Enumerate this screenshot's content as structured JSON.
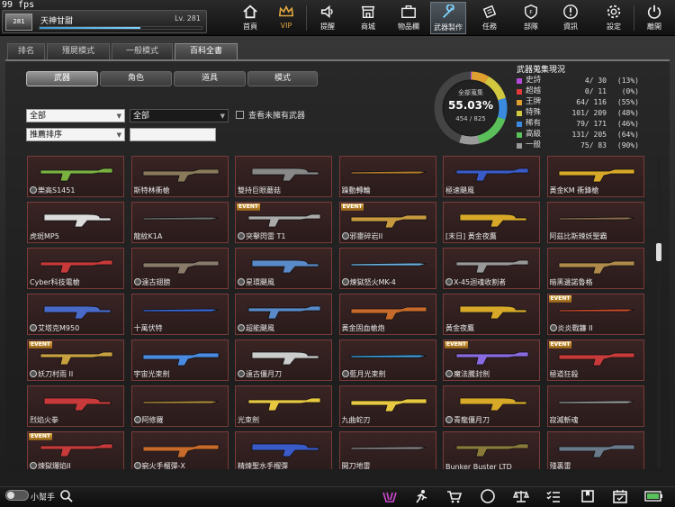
{
  "fps": "99 fps",
  "player": {
    "name": "天神甘甜",
    "level": "Lv. 281",
    "rank": "281",
    "exp_fraction": 0.62
  },
  "nav": [
    {
      "label": "首頁",
      "icon": "home-icon"
    },
    {
      "label": "VIP",
      "icon": "crown-icon"
    },
    {
      "label": "提醒",
      "icon": "speaker-icon"
    },
    {
      "label": "商城",
      "icon": "shop-icon"
    },
    {
      "label": "物品欄",
      "icon": "briefcase-icon"
    },
    {
      "label": "武器製作",
      "icon": "wrench-icon"
    },
    {
      "label": "任務",
      "icon": "ticket-icon"
    },
    {
      "label": "部隊",
      "icon": "clan-icon"
    },
    {
      "label": "資訊",
      "icon": "info-icon"
    },
    {
      "label": "設定",
      "icon": "gear-icon"
    },
    {
      "label": "離開",
      "icon": "power-icon"
    }
  ],
  "main_tabs": [
    "排名",
    "殭屍模式",
    "一般模式",
    "百科全書"
  ],
  "sub_tabs": [
    "武器",
    "角色",
    "道具",
    "模式"
  ],
  "filters": {
    "category": "全部",
    "subcategory": "全部",
    "sort": "推薦排序",
    "search_value": "",
    "owned_only_label": "查看未擁有武器"
  },
  "collection": {
    "title": "全部蒐集",
    "percent": "55.03%",
    "count": "454 / 825",
    "fraction": 0.5503
  },
  "stats": {
    "title": "武器蒐集現況",
    "rows": [
      {
        "name": "史詩",
        "count": "4/  30",
        "pct": "(13%)",
        "color": "#b64ad8"
      },
      {
        "name": "超越",
        "count": "0/  11",
        "pct": "(0%)",
        "color": "#e03a3a"
      },
      {
        "name": "王牌",
        "count": "64/ 116",
        "pct": "(55%)",
        "color": "#e0a030"
      },
      {
        "name": "特殊",
        "count": "101/ 209",
        "pct": "(48%)",
        "color": "#d2c840"
      },
      {
        "name": "稀有",
        "count": "79/ 171",
        "pct": "(46%)",
        "color": "#3a8ae0"
      },
      {
        "name": "高級",
        "count": "131/ 205",
        "pct": "(64%)",
        "color": "#5ac05a"
      },
      {
        "name": "一般",
        "count": "75/  83",
        "pct": "(90%)",
        "color": "#9a9a9a"
      }
    ]
  },
  "weapons": [
    {
      "name": "樂高S1451",
      "gear": true,
      "event": false,
      "color": "#7ab040"
    },
    {
      "name": "斯特林衝槍",
      "gear": false,
      "event": false,
      "color": "#8a7a5a"
    },
    {
      "name": "雙持巨眼蘑菇",
      "gear": false,
      "event": false,
      "color": "#888888"
    },
    {
      "name": "躁動轉輪",
      "gear": false,
      "event": false,
      "color": "#b0782a"
    },
    {
      "name": "極速颶風",
      "gear": false,
      "event": false,
      "color": "#3a5ac8"
    },
    {
      "name": "黃金KM 衝鋒槍",
      "gear": false,
      "event": false,
      "color": "#d8a828"
    },
    {
      "name": "虎斑MP5",
      "gear": false,
      "event": false,
      "color": "#dddddd"
    },
    {
      "name": "龍紋K1A",
      "gear": false,
      "event": false,
      "color": "#6a6a6a"
    },
    {
      "name": "突擊閃雷 T1",
      "gear": true,
      "event": true,
      "color": "#aaaaaa"
    },
    {
      "name": "邪靈碎岩II",
      "gear": true,
      "event": true,
      "color": "#c89a40"
    },
    {
      "name": "[末日] 黃金夜鷹",
      "gear": false,
      "event": false,
      "color": "#d8a828"
    },
    {
      "name": "阿茲比斯辣妖聖霸",
      "gear": false,
      "event": false,
      "color": "#8a6a4a"
    },
    {
      "name": "Cyber科技電槍",
      "gear": false,
      "event": false,
      "color": "#c83a3a"
    },
    {
      "name": "遠古翅膀",
      "gear": true,
      "event": false,
      "color": "#8a7a6a"
    },
    {
      "name": "星環颶風",
      "gear": true,
      "event": false,
      "color": "#5a8ac8"
    },
    {
      "name": "煉獄怒火MK-4",
      "gear": true,
      "event": false,
      "color": "#6ab0e0"
    },
    {
      "name": "X-45迴魂收割者",
      "gear": true,
      "event": false,
      "color": "#999999"
    },
    {
      "name": "暗黑邊諾魯格",
      "gear": false,
      "event": false,
      "color": "#b08a4a"
    },
    {
      "name": "艾塔克M950",
      "gear": true,
      "event": false,
      "color": "#4a6ac8"
    },
    {
      "name": "十萬伏特",
      "gear": false,
      "event": false,
      "color": "#3a6ae0"
    },
    {
      "name": "超能颶風",
      "gear": true,
      "event": false,
      "color": "#5a8ac8"
    },
    {
      "name": "黃金固血槍炮",
      "gear": false,
      "event": false,
      "color": "#c86a2a"
    },
    {
      "name": "黃金夜鷹",
      "gear": false,
      "event": false,
      "color": "#d8a828"
    },
    {
      "name": "炎炎戰鐮 II",
      "gear": true,
      "event": true,
      "color": "#c84a2a"
    },
    {
      "name": "妖刀村雨 II",
      "gear": true,
      "event": true,
      "color": "#c8a040"
    },
    {
      "name": "宇宙光束劍",
      "gear": false,
      "event": false,
      "color": "#4a8ae0"
    },
    {
      "name": "遠古僵月刀",
      "gear": true,
      "event": false,
      "color": "#cccccc"
    },
    {
      "name": "藍月光束劍",
      "gear": true,
      "event": false,
      "color": "#3aa0e0"
    },
    {
      "name": "魔法騰封劍",
      "gear": true,
      "event": true,
      "color": "#8a6ae0"
    },
    {
      "name": "極道狂殺",
      "gear": false,
      "event": true,
      "color": "#c83a3a"
    },
    {
      "name": "烈焰火拳",
      "gear": false,
      "event": false,
      "color": "#c83a3a"
    },
    {
      "name": "阿修羅",
      "gear": true,
      "event": false,
      "color": "#b08a3a"
    },
    {
      "name": "光束劍",
      "gear": false,
      "event": false,
      "color": "#e8c840"
    },
    {
      "name": "九曲蛇刃",
      "gear": false,
      "event": false,
      "color": "#e8c840"
    },
    {
      "name": "青龍僵月刀",
      "gear": true,
      "event": false,
      "color": "#d8a828"
    },
    {
      "name": "寂滅斬魂",
      "gear": false,
      "event": false,
      "color": "#999999"
    },
    {
      "name": "煉獄爆焰II",
      "gear": true,
      "event": true,
      "color": "#c83a3a"
    },
    {
      "name": "窮火手榴彈-X",
      "gear": true,
      "event": false,
      "color": "#c86a2a"
    },
    {
      "name": "精煉聖水手榴彈",
      "gear": false,
      "event": false,
      "color": "#3a5ac8"
    },
    {
      "name": "開刀地雷",
      "gear": false,
      "event": false,
      "color": "#888888"
    },
    {
      "name": "Bunker Buster LTD",
      "gear": false,
      "event": false,
      "color": "#8a7a3a"
    },
    {
      "name": "殘裏雷",
      "gear": false,
      "event": false,
      "color": "#6a7a8a"
    }
  ],
  "bottom": {
    "helper_label": "小幫手",
    "icons": [
      "weapon-rack-icon",
      "running-icon",
      "cart-icon",
      "compass-icon",
      "scale-icon",
      "checklist-icon",
      "bookmark-icon",
      "calendar-icon",
      "battery-icon"
    ]
  }
}
